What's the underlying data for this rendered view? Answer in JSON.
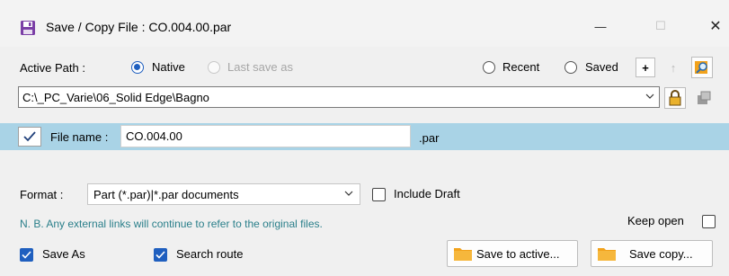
{
  "window": {
    "title": "Save / Copy File : CO.004.00.par",
    "minimize_glyph": "—",
    "maximize_glyph": "☐",
    "close_glyph": "✕"
  },
  "path_row": {
    "active_path_label": "Active Path :",
    "native_label": "Native",
    "last_save_label": "Last save as",
    "recent_label": "Recent",
    "saved_label": "Saved",
    "plus_label": "+",
    "up_arrow_label": "↑"
  },
  "path": {
    "value": "C:\\_PC_Varie\\06_Solid Edge\\Bagno"
  },
  "file": {
    "label": "File name :",
    "value": "CO.004.00",
    "extension": ".par"
  },
  "format": {
    "label": "Format :",
    "selected": "Part (*.par)|*.par documents",
    "include_draft_label": "Include Draft"
  },
  "note": "N. B. Any external links will continue to refer to the original files.",
  "keep_open_label": "Keep open",
  "save_as_label": "Save As",
  "search_route_label": "Search route",
  "buttons": {
    "save_to_active": "Save to active...",
    "save_copy": "Save copy..."
  },
  "colors": {
    "accent": "#1f5fbf",
    "band": "#a9d3e6",
    "note_text": "#2a7f8a",
    "folder": "#f2a21b"
  }
}
